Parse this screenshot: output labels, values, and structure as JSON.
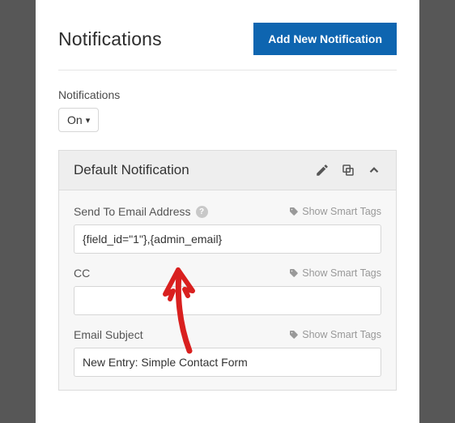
{
  "header": {
    "title": "Notifications",
    "add_button": "Add New Notification"
  },
  "toggle": {
    "label": "Notifications",
    "value": "On"
  },
  "card": {
    "title": "Default Notification"
  },
  "fields": {
    "send_to": {
      "label": "Send To Email Address",
      "value": "{field_id=\"1\"},{admin_email}",
      "smart": "Show Smart Tags"
    },
    "cc": {
      "label": "CC",
      "value": "",
      "smart": "Show Smart Tags"
    },
    "subject": {
      "label": "Email Subject",
      "value": "New Entry: Simple Contact Form",
      "smart": "Show Smart Tags"
    }
  }
}
